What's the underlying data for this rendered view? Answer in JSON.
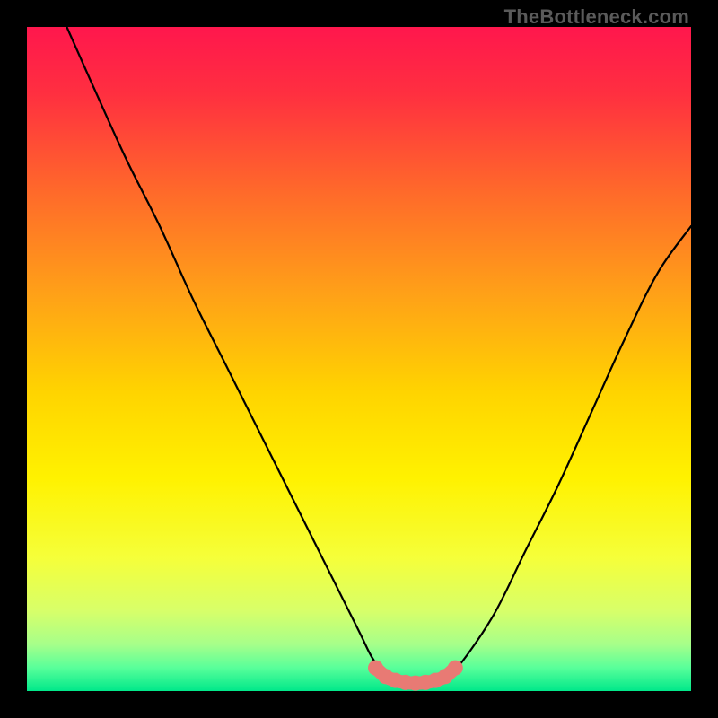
{
  "watermark": "TheBottleneck.com",
  "colors": {
    "frame": "#000000",
    "gradient_stops": [
      {
        "offset": 0.0,
        "color": "#ff174d"
      },
      {
        "offset": 0.1,
        "color": "#ff2f40"
      },
      {
        "offset": 0.25,
        "color": "#ff6a2a"
      },
      {
        "offset": 0.4,
        "color": "#ffa018"
      },
      {
        "offset": 0.55,
        "color": "#ffd400"
      },
      {
        "offset": 0.68,
        "color": "#fff200"
      },
      {
        "offset": 0.8,
        "color": "#f5ff3a"
      },
      {
        "offset": 0.88,
        "color": "#d7ff6a"
      },
      {
        "offset": 0.93,
        "color": "#a6ff8a"
      },
      {
        "offset": 0.965,
        "color": "#58ff9a"
      },
      {
        "offset": 1.0,
        "color": "#00e88a"
      }
    ],
    "curve": "#000000",
    "marker_fill": "#e87a74",
    "marker_stroke": "#cf5f57"
  },
  "chart_data": {
    "type": "line",
    "title": "",
    "xlabel": "",
    "ylabel": "",
    "xlim": [
      0,
      100
    ],
    "ylim": [
      0,
      100
    ],
    "series": [
      {
        "name": "bottleneck-curve",
        "x": [
          6,
          10,
          15,
          20,
          25,
          30,
          35,
          40,
          45,
          50,
          52,
          54,
          56,
          58,
          60,
          62,
          64,
          70,
          75,
          80,
          85,
          90,
          95,
          100
        ],
        "y": [
          100,
          91,
          80,
          70,
          59,
          49,
          39,
          29,
          19,
          9,
          5,
          2.5,
          1.5,
          1.2,
          1.2,
          1.5,
          2.5,
          11,
          21,
          31,
          42,
          53,
          63,
          70
        ]
      }
    ],
    "markers": {
      "name": "optimal-range",
      "x": [
        52.5,
        54,
        55.5,
        57,
        58.5,
        60,
        61.5,
        63,
        64.5
      ],
      "y": [
        3.5,
        2.2,
        1.6,
        1.3,
        1.2,
        1.3,
        1.6,
        2.2,
        3.5
      ]
    }
  }
}
